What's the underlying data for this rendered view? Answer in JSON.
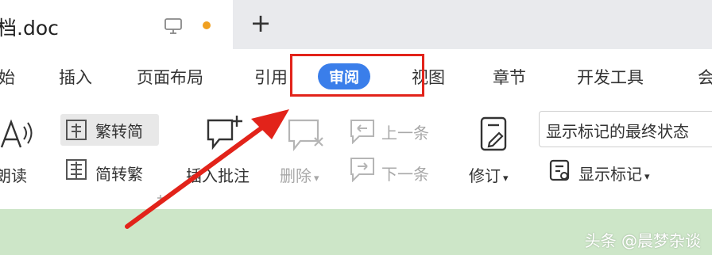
{
  "tab": {
    "doc_name": "档.doc",
    "new_tab": "+"
  },
  "menu": {
    "items": [
      "始",
      "插入",
      "页面布局",
      "引用",
      "审阅",
      "视图",
      "章节",
      "开发工具",
      "会"
    ],
    "active": "审阅"
  },
  "ribbon": {
    "read_aloud": "朗读",
    "trad_to_simp": "繁转简",
    "simp_to_trad": "简转繁",
    "insert_comment": "插入批注",
    "delete": "删除",
    "prev_item": "上一条",
    "next_item": "下一条",
    "revise": "修订",
    "markup_mode": "显示标记的最终状态",
    "show_markup": "显示标记"
  },
  "watermark": "头条 @晨梦杂谈",
  "colors": {
    "accent": "#3a7eea",
    "annotation_red": "#e2231a",
    "doc_bg": "#cde6c8"
  }
}
